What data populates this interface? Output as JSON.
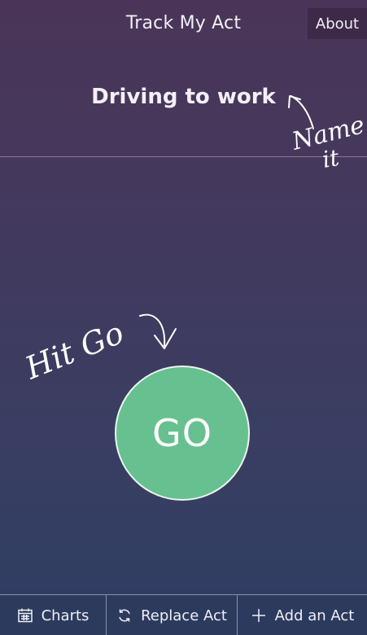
{
  "header": {
    "title": "Track My Act",
    "about_label": "About"
  },
  "main": {
    "act_name": "Driving to work",
    "go_label": "GO"
  },
  "annotations": {
    "name_hint": [
      "Name",
      "it"
    ],
    "go_hint": "Hit Go"
  },
  "bottom_bar": {
    "charts_label": "Charts",
    "replace_label": "Replace Act",
    "add_label": "Add an Act"
  },
  "icons": {
    "charts": "calendar-icon",
    "replace": "refresh-icon",
    "add": "plus-icon"
  },
  "colors": {
    "go_button": "#67c08f",
    "bottom_bar": "#2c3a5d"
  }
}
